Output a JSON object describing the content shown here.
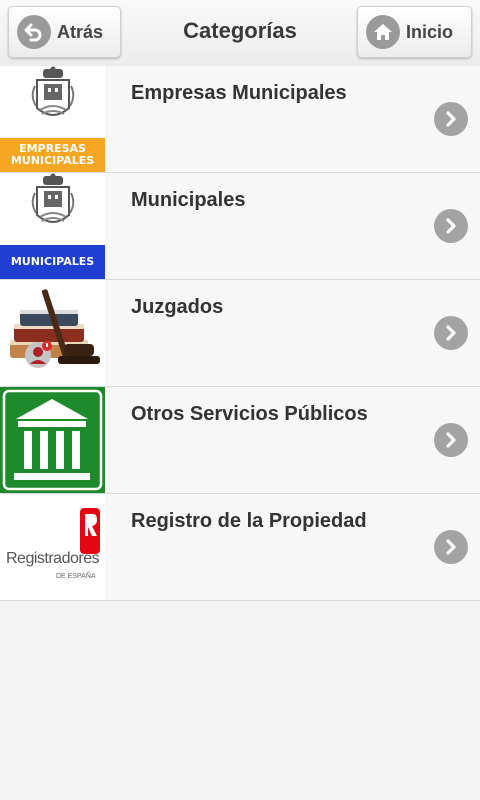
{
  "header": {
    "back_label": "Atrás",
    "title": "Categorías",
    "home_label": "Inicio"
  },
  "categories": [
    {
      "title": "Empresas Municipales",
      "badge": "EMPRESAS MUNICIPALES",
      "badge_color": "#f5a623"
    },
    {
      "title": "Municipales",
      "badge": "MUNICIPALES",
      "badge_color": "#1f3fd1"
    },
    {
      "title": "Juzgados"
    },
    {
      "title": "Otros Servicios Públicos",
      "icon_bg": "#1e8a2c"
    },
    {
      "title": "Registro de la Propiedad",
      "logo_text": "Registradores",
      "logo_sub": "DE ESPAÑA",
      "logo_color": "#e30613"
    }
  ]
}
